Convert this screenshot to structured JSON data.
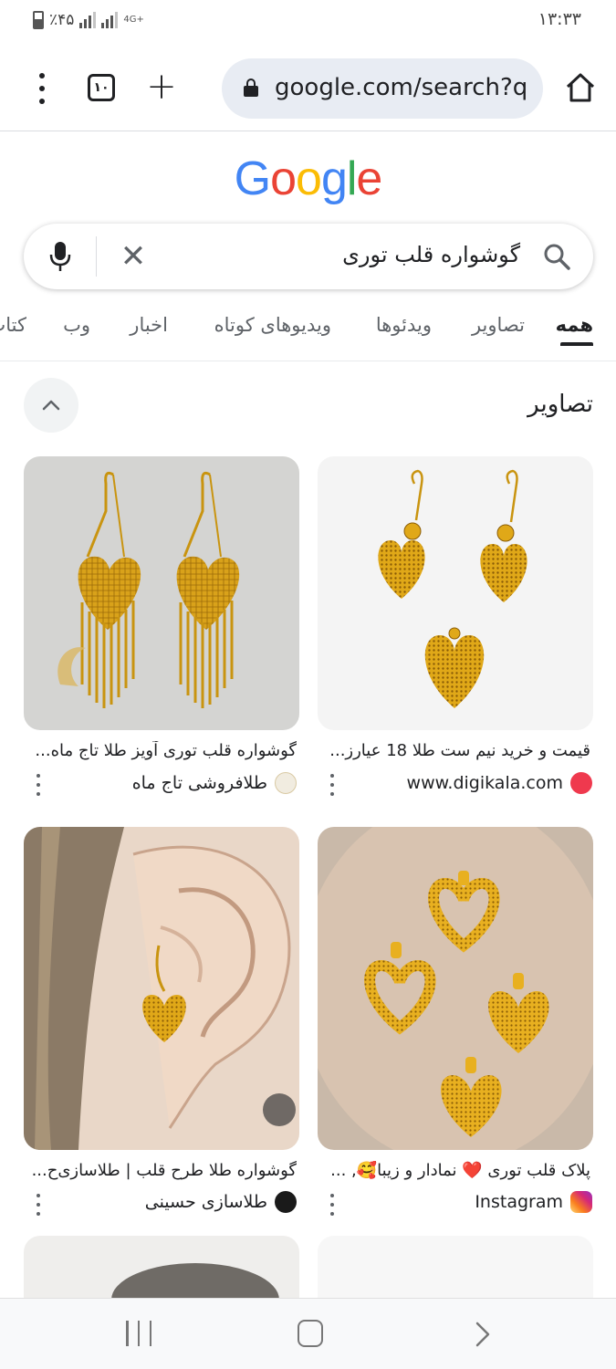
{
  "status_bar": {
    "battery": "٪۴۵",
    "network": "4G+",
    "time": "۱۳:۳۳"
  },
  "browser": {
    "tab_count": "۱۰",
    "url": "google.com/search?q"
  },
  "logo": {
    "letters": [
      "G",
      "o",
      "o",
      "g",
      "l",
      "e"
    ],
    "colors": [
      "#4285F4",
      "#EA4335",
      "#FBBC05",
      "#4285F4",
      "#34A853",
      "#EA4335"
    ]
  },
  "search": {
    "query": "گوشواره قلب توری"
  },
  "tabs": [
    {
      "label": "همه",
      "active": true
    },
    {
      "label": "تصاویر"
    },
    {
      "label": "ویدئوها"
    },
    {
      "label": "ویدیوهای کوتاه"
    },
    {
      "label": "اخبار"
    },
    {
      "label": "وب"
    },
    {
      "label": "کتاب"
    }
  ],
  "images_section": {
    "title": "تصاویر"
  },
  "results": [
    {
      "title": "قیمت و خرید نیم ست طلا 18 عیارز...",
      "source": "www.digikala.com",
      "source_icon_color": "#EF394E"
    },
    {
      "title": "گوشواره قلب توری آویز طلا تاج ماه...",
      "source": "طلافروشی تاج ماه",
      "source_icon_color": "#D9C9A3"
    },
    {
      "title": "پلاک قلب توری ❤️ نمادار و زیبا🥰, ...",
      "source": "Instagram",
      "source_icon_color": "#D62976"
    },
    {
      "title": "گوشواره طلا طرح قلب | طلاسازی‌ح...",
      "source": "طلاسازی حسینی",
      "source_icon_color": "#1a1a1a"
    }
  ],
  "colors": {
    "accent_gold": "#E0A818",
    "url_bar_bg": "#e8ecf3",
    "text": "#202124",
    "secondary_text": "#5f6368"
  }
}
